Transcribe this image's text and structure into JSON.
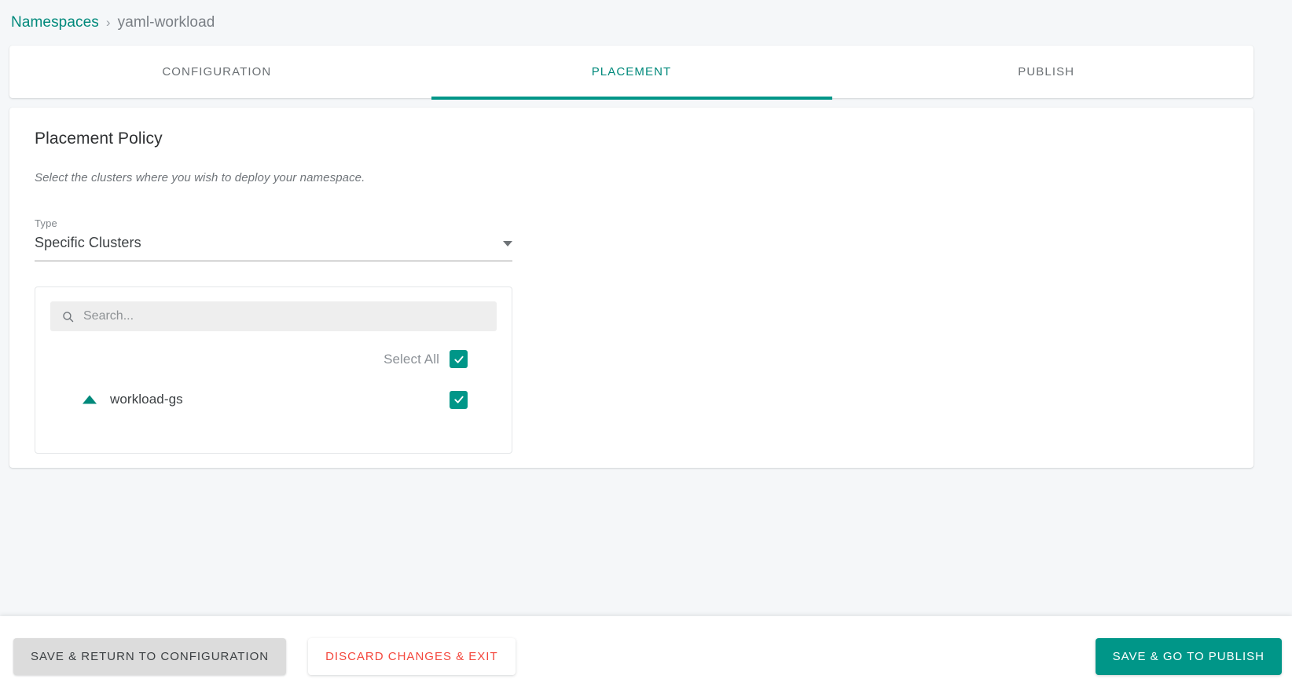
{
  "breadcrumb": {
    "root": "Namespaces",
    "separator": "›",
    "current": "yaml-workload"
  },
  "tabs": [
    {
      "label": "CONFIGURATION",
      "active": false
    },
    {
      "label": "PLACEMENT",
      "active": true
    },
    {
      "label": "PUBLISH",
      "active": false
    }
  ],
  "placement": {
    "title": "Placement Policy",
    "subtitle": "Select the clusters where you wish to deploy your namespace.",
    "type_label": "Type",
    "type_value": "Specific Clusters",
    "search_placeholder": "Search...",
    "search_value": "",
    "select_all_label": "Select All",
    "select_all_checked": true,
    "clusters": [
      {
        "name": "workload-gs",
        "checked": true,
        "icon": "triangle-cluster-icon"
      }
    ]
  },
  "footer": {
    "save_return": "SAVE & RETURN TO CONFIGURATION",
    "discard": "DISCARD CHANGES & EXIT",
    "save_publish": "SAVE & GO TO PUBLISH"
  },
  "colors": {
    "accent": "#009688",
    "accent_link": "#00897b",
    "danger": "#f4463c",
    "page_bg": "#f5f7f9"
  }
}
